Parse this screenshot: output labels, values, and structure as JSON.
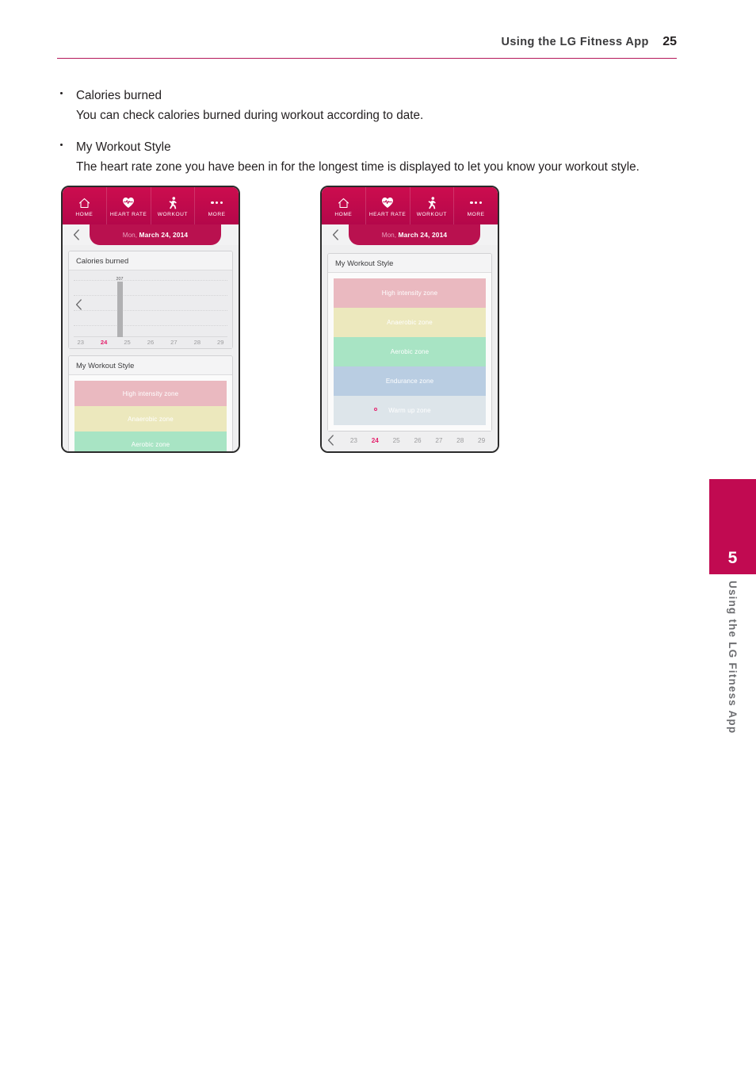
{
  "header": {
    "title": "Using the LG Fitness App",
    "page_number": "25",
    "rule_color": "#b5175a"
  },
  "body": {
    "bullets": [
      {
        "title": "Calories burned",
        "text": "You can check calories burned during workout according to date."
      },
      {
        "title": "My Workout Style",
        "text": "The heart rate zone you have been in for the longest time is displayed to let you know your workout style."
      }
    ]
  },
  "tabs": [
    {
      "label": "HOME",
      "icon": "home-icon"
    },
    {
      "label": "HEART RATE",
      "icon": "heart-rate-icon"
    },
    {
      "label": "WORKOUT",
      "icon": "workout-runner-icon"
    },
    {
      "label": "MORE",
      "icon": "more-dots-icon"
    }
  ],
  "date_bar": {
    "day_of_week": "Mon,",
    "date": "March 24, 2014",
    "back_icon": "chevron-left-icon"
  },
  "phone_left": {
    "card_calories_title": "Calories burned",
    "card_style_title": "My Workout Style",
    "chart_prev_icon": "chevron-left-icon",
    "zones_visible": [
      {
        "label": "High intensity zone",
        "color": "#eab9c0"
      },
      {
        "label": "Anaerobic zone",
        "color": "#ece8bd"
      },
      {
        "label": "Aerobic zone",
        "color": "#a8e4c4"
      }
    ]
  },
  "phone_right": {
    "card_style_title": "My Workout Style",
    "zones": [
      {
        "label": "High intensity zone",
        "color": "#eab9c0",
        "marker": false
      },
      {
        "label": "Anaerobic zone",
        "color": "#ece8bd",
        "marker": false
      },
      {
        "label": "Aerobic zone",
        "color": "#a8e4c4",
        "marker": false
      },
      {
        "label": "Endurance zone",
        "color": "#b9cde2",
        "marker": false
      },
      {
        "label": "Warm up zone",
        "color": "#dde5ea",
        "marker": true
      }
    ],
    "date_strip": {
      "back_icon": "chevron-left-icon",
      "dates": [
        "23",
        "24",
        "25",
        "26",
        "27",
        "28",
        "29"
      ],
      "selected": "24"
    }
  },
  "chart_data": {
    "type": "bar",
    "title": "Calories burned",
    "categories": [
      "23",
      "24",
      "25",
      "26",
      "27",
      "28",
      "29"
    ],
    "values": [
      0,
      207,
      0,
      0,
      0,
      0,
      0
    ],
    "data_labels": [
      "",
      "207",
      "",
      "",
      "",
      "",
      ""
    ],
    "selected_category": "24",
    "xlabel": "",
    "ylabel": "",
    "ylim": [
      0,
      240
    ],
    "grid": true,
    "gridlines": 5,
    "legend": "none",
    "bar_color": "#b0b0b2",
    "selected_tick_color": "#e4206c"
  },
  "side_tab": {
    "chapter_number": "5",
    "chapter_label": "Using the LG Fitness App",
    "color": "#c10a51"
  }
}
